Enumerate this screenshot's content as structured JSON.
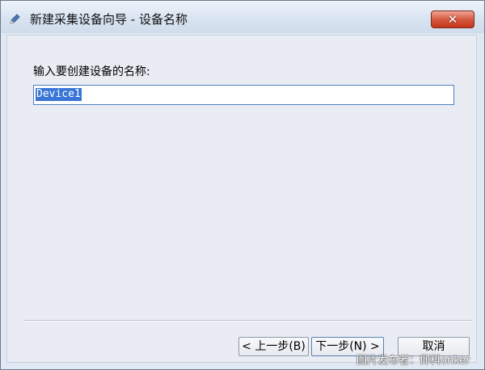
{
  "window": {
    "title": "新建采集设备向导 - 设备名称",
    "close_symbol": "✕"
  },
  "form": {
    "prompt": "输入要创建设备的名称:",
    "device_name_value": "Device1"
  },
  "buttons": {
    "prev_label": "< 上一步(B)",
    "next_label": "下一步(N) >",
    "cancel_label": "取消"
  },
  "watermark": "图片发布者：仰科onker",
  "icons": {
    "title_icon": "wizard-pen-icon",
    "close_icon": "close-icon"
  },
  "colors": {
    "close_button": "#c7351c",
    "selection": "#3875d7"
  }
}
